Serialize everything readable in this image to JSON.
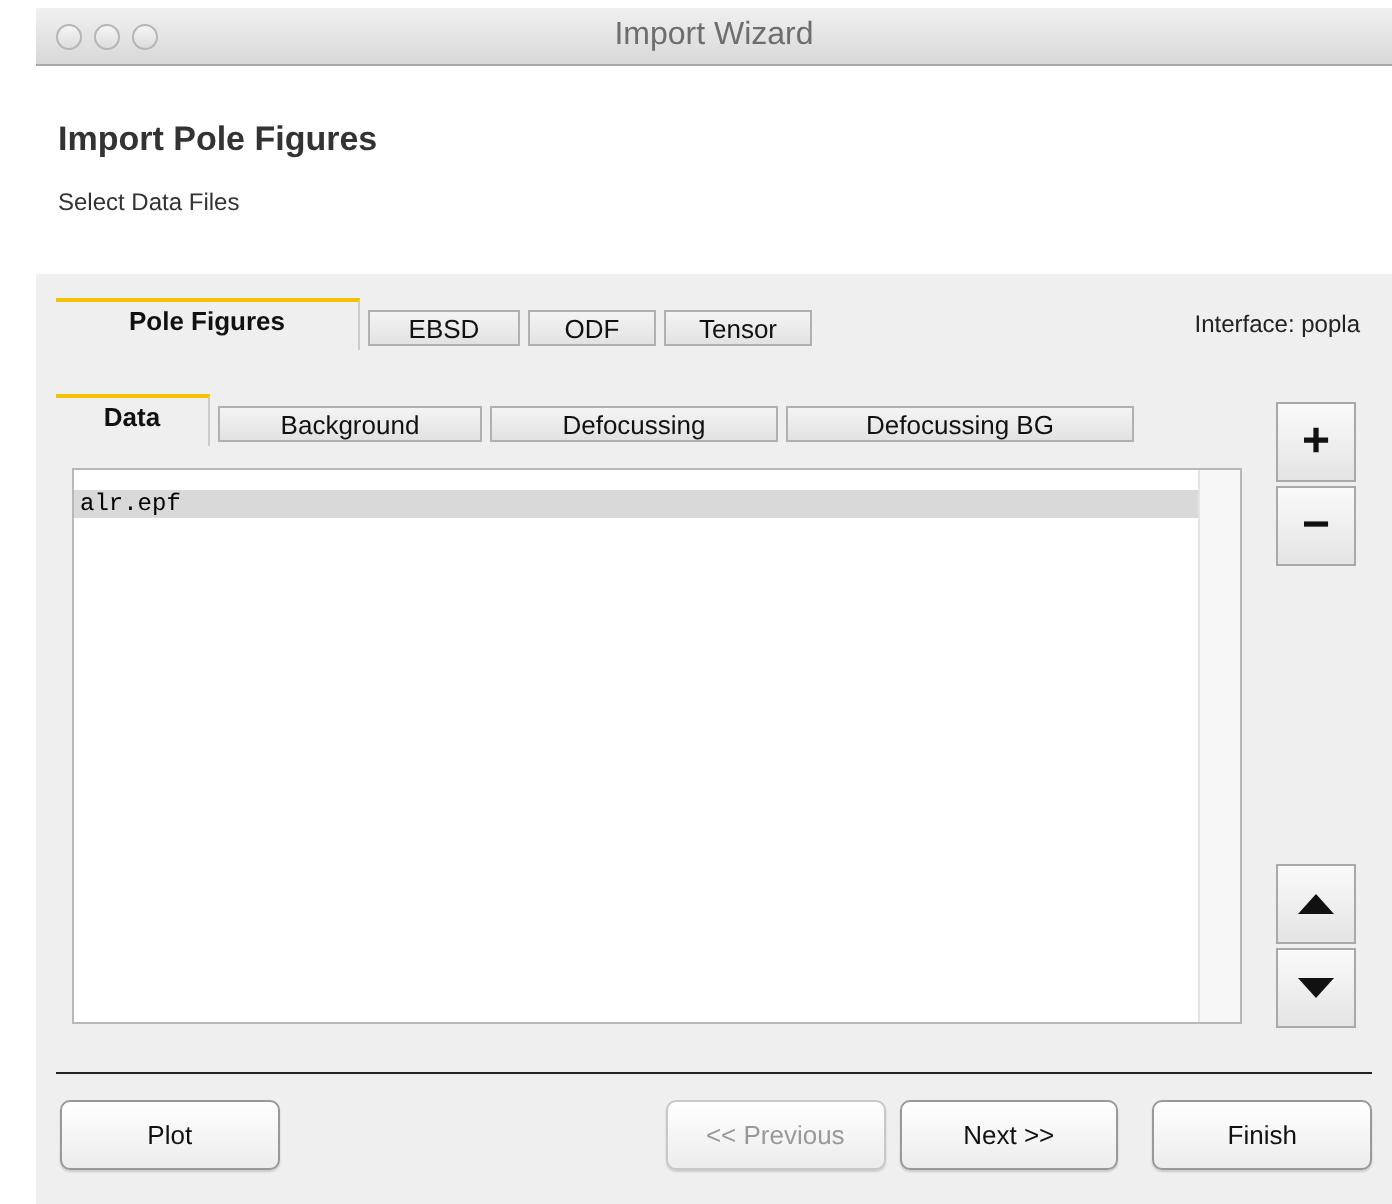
{
  "window": {
    "title": "Import Wizard"
  },
  "header": {
    "title": "Import Pole Figures",
    "subtitle": "Select Data Files"
  },
  "tabs": [
    {
      "label": "Pole Figures",
      "selected": true
    },
    {
      "label": "EBSD",
      "selected": false
    },
    {
      "label": "ODF",
      "selected": false
    },
    {
      "label": "Tensor",
      "selected": false
    }
  ],
  "interface_label": "Interface: popla",
  "subtabs": [
    {
      "label": "Data",
      "selected": true
    },
    {
      "label": "Background",
      "selected": false
    },
    {
      "label": "Defocussing",
      "selected": false
    },
    {
      "label": "Defocussing BG",
      "selected": false
    }
  ],
  "files": [
    {
      "name": "alr.epf",
      "selected": true
    }
  ],
  "side_buttons": [
    {
      "kind": "add",
      "label": "+"
    },
    {
      "kind": "remove",
      "label": "−"
    },
    {
      "kind": "up"
    },
    {
      "kind": "down"
    }
  ],
  "buttons": [
    {
      "label": "Plot",
      "disabled": false
    },
    {
      "label": "<< Previous",
      "disabled": true
    },
    {
      "label": "Next >>",
      "disabled": false
    },
    {
      "label": "Finish",
      "disabled": false
    }
  ]
}
